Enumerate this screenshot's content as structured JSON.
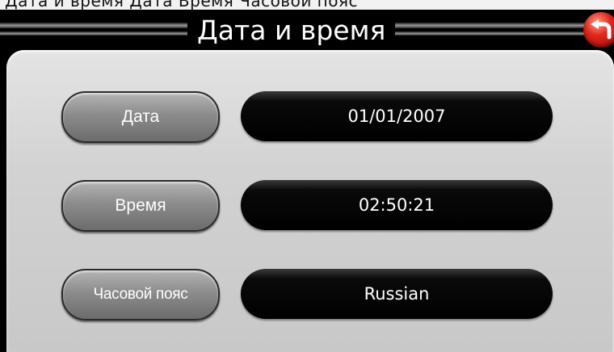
{
  "top_strip": {
    "text": "Дата и время Дата Время Часовой пояс"
  },
  "header": {
    "title": "Дата и время",
    "back_icon": "back-arrow-icon"
  },
  "rows": [
    {
      "label": "Дата",
      "value": "01/01/2007"
    },
    {
      "label": "Время",
      "value": "02:50:21"
    },
    {
      "label": "Часовой пояс",
      "value": "Russian"
    }
  ],
  "colors": {
    "panel": "#d2d2d2",
    "label_button": "#8c8c8c",
    "value_field": "#000000",
    "back_button": "#e0261a"
  }
}
